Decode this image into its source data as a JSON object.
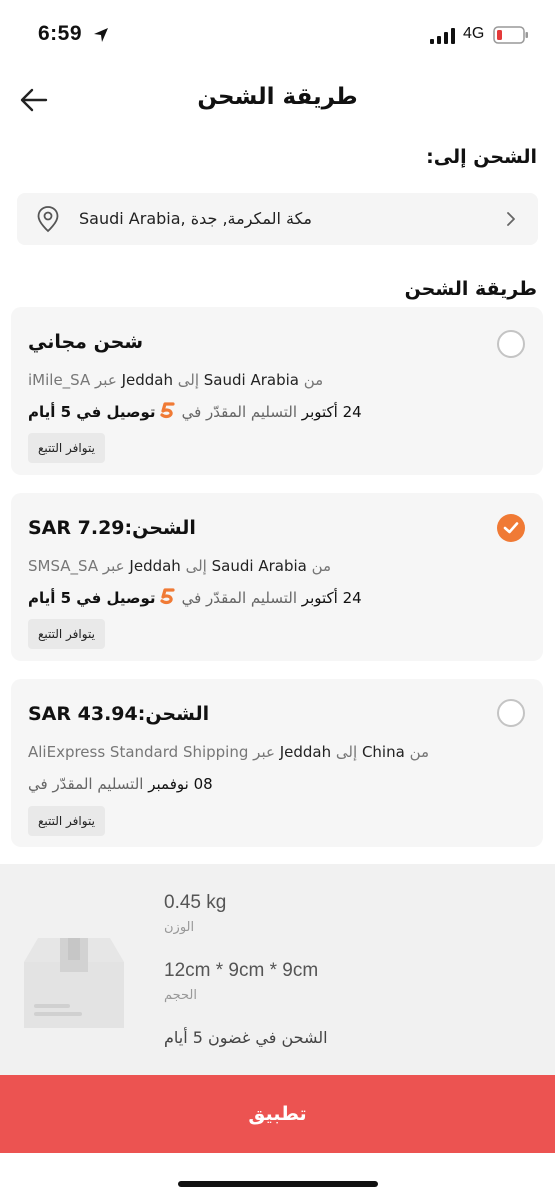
{
  "status": {
    "time": "6:59",
    "network": "4G"
  },
  "header": {
    "title": "طريقة الشحن"
  },
  "ship_to": {
    "label": "الشحن إلى:",
    "address": "Saudi Arabia, مكة المكرمة, جدة"
  },
  "method_section": {
    "label": "طريقة الشحن"
  },
  "options": [
    {
      "title": "شحن مجاني",
      "route_from_prefix": "من",
      "route_from": "Saudi Arabia",
      "route_to_prefix": "إلى",
      "route_to": "Jeddah",
      "route_via_prefix": "عبر",
      "carrier": "iMile_SA",
      "delivery_prefix": "التسليم المقدّر في",
      "delivery_date": "24 أكتوبر",
      "fast_label": "توصيل في 5 أيام",
      "tracking": "يتوافر التتبع",
      "selected": false
    },
    {
      "title": "الشحن:SAR 7.29",
      "route_from_prefix": "من",
      "route_from": "Saudi Arabia",
      "route_to_prefix": "إلى",
      "route_to": "Jeddah",
      "route_via_prefix": "عبر",
      "carrier": "SMSA_SA",
      "delivery_prefix": "التسليم المقدّر في",
      "delivery_date": "24 أكتوبر",
      "fast_label": "توصيل في 5 أيام",
      "tracking": "يتوافر التتبع",
      "selected": true
    },
    {
      "title": "الشحن:SAR 43.94",
      "route_from_prefix": "من",
      "route_from": "China",
      "route_to_prefix": "إلى",
      "route_to": "Jeddah",
      "route_via_prefix": "عبر",
      "carrier": "AliExpress Standard Shipping",
      "delivery_prefix": "التسليم المقدّر في",
      "delivery_date": "08 نوفمبر",
      "tracking": "يتوافر التتبع",
      "selected": false
    }
  ],
  "package": {
    "weight_value": "0.45 kg",
    "weight_label": "الوزن",
    "size_value": "12cm * 9cm * 9cm",
    "size_label": "الحجم",
    "ships_within": "الشحن في غضون 5 أيام"
  },
  "apply_label": "تطبيق",
  "colors": {
    "accent": "#f07a35",
    "apply": "#ec5351",
    "card_bg": "#f6f6f6"
  },
  "icons": [
    "location-arrow-icon",
    "signal-icon",
    "battery-icon",
    "back-arrow-icon",
    "location-pin-icon",
    "chevron-right-icon",
    "radio-check-icon",
    "fast-delivery-logo-icon",
    "package-box-icon"
  ]
}
